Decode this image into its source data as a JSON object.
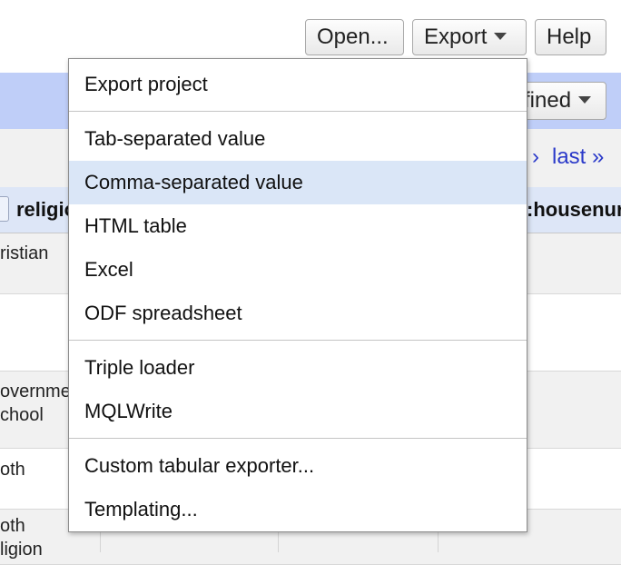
{
  "toolbar": {
    "open_label": "Open...",
    "export_label": "Export",
    "help_label": "Help"
  },
  "background": {
    "header_dropdown_label": "fined",
    "pager_next": "›",
    "pager_last": "last »",
    "columns": [
      "religio",
      ":housenur"
    ],
    "rows": [
      "ristian",
      "",
      "overnme\nchool",
      "oth",
      "oth\nligion"
    ]
  },
  "export_menu": {
    "groups": [
      [
        "Export project"
      ],
      [
        "Tab-separated value",
        "Comma-separated value",
        "HTML table",
        "Excel",
        "ODF spreadsheet"
      ],
      [
        "Triple loader",
        "MQLWrite"
      ],
      [
        "Custom tabular exporter...",
        "Templating..."
      ]
    ],
    "highlighted": "Comma-separated value",
    "highlight_color": "#dae6f7"
  }
}
